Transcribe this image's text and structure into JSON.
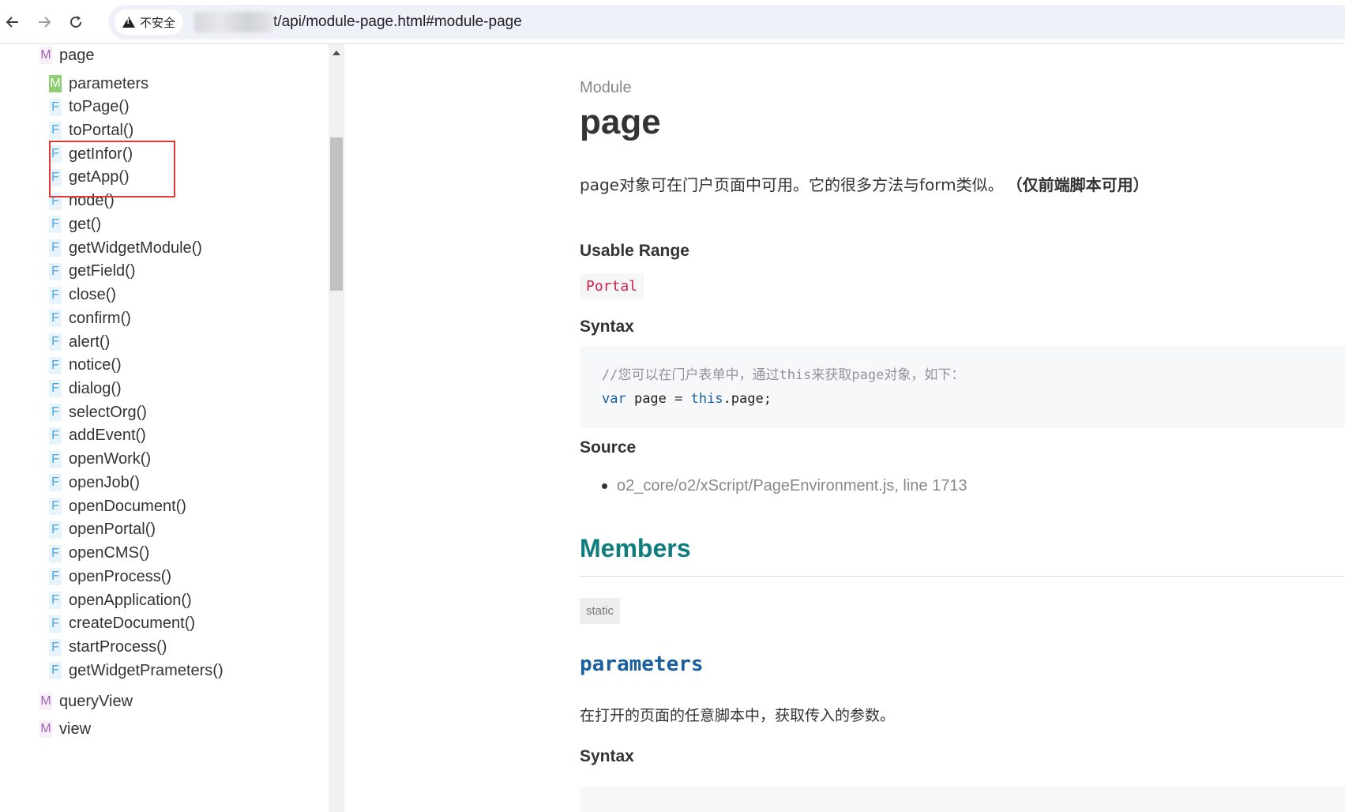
{
  "browser": {
    "back_icon": "arrow-left",
    "forward_icon": "arrow-right",
    "reload_icon": "reload",
    "security_label": "不安全",
    "url": "t/api/module-page.html#module-page"
  },
  "sidebar": {
    "top_item": {
      "kind": "M",
      "label": "page"
    },
    "children": [
      {
        "kind": "M",
        "label": "parameters"
      },
      {
        "kind": "F",
        "label": "toPage()"
      },
      {
        "kind": "F",
        "label": "toPortal()"
      },
      {
        "kind": "F",
        "label": "getInfor()"
      },
      {
        "kind": "F",
        "label": "getApp()"
      },
      {
        "kind": "F",
        "label": "node()"
      },
      {
        "kind": "F",
        "label": "get()"
      },
      {
        "kind": "F",
        "label": "getWidgetModule()"
      },
      {
        "kind": "F",
        "label": "getField()"
      },
      {
        "kind": "F",
        "label": "close()"
      },
      {
        "kind": "F",
        "label": "confirm()"
      },
      {
        "kind": "F",
        "label": "alert()"
      },
      {
        "kind": "F",
        "label": "notice()"
      },
      {
        "kind": "F",
        "label": "dialog()"
      },
      {
        "kind": "F",
        "label": "selectOrg()"
      },
      {
        "kind": "F",
        "label": "addEvent()"
      },
      {
        "kind": "F",
        "label": "openWork()"
      },
      {
        "kind": "F",
        "label": "openJob()"
      },
      {
        "kind": "F",
        "label": "openDocument()"
      },
      {
        "kind": "F",
        "label": "openPortal()"
      },
      {
        "kind": "F",
        "label": "openCMS()"
      },
      {
        "kind": "F",
        "label": "openProcess()"
      },
      {
        "kind": "F",
        "label": "openApplication()"
      },
      {
        "kind": "F",
        "label": "createDocument()"
      },
      {
        "kind": "F",
        "label": "startProcess()"
      },
      {
        "kind": "F",
        "label": "getWidgetPrameters()"
      }
    ],
    "bottom_items": [
      {
        "kind": "M",
        "label": "queryView"
      },
      {
        "kind": "M",
        "label": "view"
      }
    ]
  },
  "main": {
    "module_label": "Module",
    "title": "page",
    "description": "page对象可在门户页面中可用。它的很多方法与form类似。",
    "description_bold": "（仅前端脚本可用）",
    "usable_range_heading": "Usable Range",
    "usable_range_value": "Portal",
    "syntax_heading": "Syntax",
    "code_line1": "//您可以在门户表单中，通过this来获取page对象，如下：",
    "code_line2": {
      "kw1": "var",
      "plain1": " page = ",
      "kw2": "this",
      "plain2": ".page;"
    },
    "source_heading": "Source",
    "source_item": "o2_core/o2/xScript/PageEnvironment.js, line 1713",
    "members_heading": "Members",
    "static_tag": "static",
    "member_name": "parameters",
    "member_desc": "在打开的页面的任意脚本中，获取传入的参数。",
    "member_syntax_heading": "Syntax"
  },
  "colors": {
    "members_heading": "#0f7d7e",
    "member_name": "#1a5fa0",
    "range_badge_text": "#c7254e",
    "highlight_box": "#e53935"
  }
}
